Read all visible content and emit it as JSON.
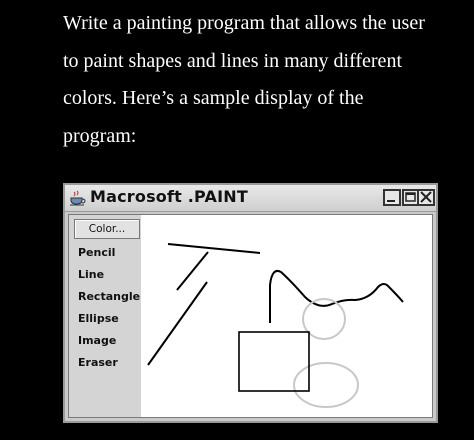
{
  "prompt": {
    "lines": [
      "Write a painting program that allows the user",
      "to paint shapes and lines in many different",
      "colors. Here’s a sample display of the",
      "program:"
    ]
  },
  "window": {
    "title": "Macrosoft .PAINT",
    "icon": "coffee-cup-icon",
    "controls": [
      "minimize-icon",
      "maximize-icon",
      "close-icon"
    ]
  },
  "toolbar": {
    "color_label": "Color...",
    "tools": [
      {
        "label": "Pencil"
      },
      {
        "label": "Line"
      },
      {
        "label": "Rectangle"
      },
      {
        "label": "Ellipse"
      },
      {
        "label": "Image"
      },
      {
        "label": "Eraser"
      }
    ]
  },
  "colors": {
    "background": "#000000",
    "prompt_text": "#ffffff",
    "window_frame": "#c9c9c9",
    "canvas": "#ffffff",
    "stroke": "#000000",
    "ellipse_stroke": "#c8c8c8"
  }
}
